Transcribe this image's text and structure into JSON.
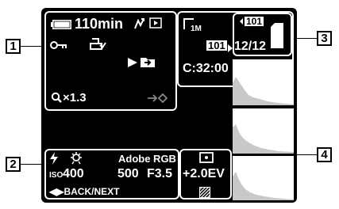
{
  "callouts": [
    "1",
    "2",
    "3",
    "4"
  ],
  "top_left": {
    "battery_time": "110min",
    "zoom": "×1.3"
  },
  "top_right": {
    "image_size": "1M",
    "folder_name": "101",
    "folder_tag": "101",
    "image_count": "12/12",
    "counter": "C:32:00"
  },
  "bottom_left": {
    "color_space": "Adobe RGB",
    "iso_label": "ISO",
    "iso_value": "400",
    "shutter": "500",
    "aperture": "F3.5",
    "nav_label": "◀▶BACK/NEXT"
  },
  "bottom_right": {
    "exposure": "+2.0EV"
  },
  "icons": [
    "battery-icon",
    "arrow-icon",
    "play-icon",
    "key-icon",
    "print-icon",
    "play-triangle-icon",
    "folder-icon",
    "magnifier-icon",
    "card-arrow-icon",
    "memory-card-icon",
    "flash-icon",
    "white-balance-icon",
    "metering-icon",
    "hatch-icon",
    "histogram-icon"
  ]
}
